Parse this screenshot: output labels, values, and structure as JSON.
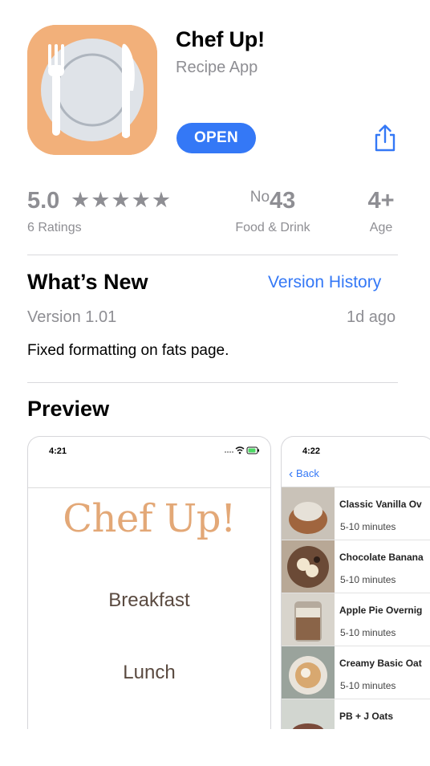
{
  "app": {
    "name": "Chef Up!",
    "subtitle": "Recipe App",
    "open_label": "OPEN",
    "icon": "fork-plate-knife-icon",
    "icon_color": "#f2b07a"
  },
  "accent_color": "#3478f6",
  "ratings": {
    "value": "5.0",
    "stars": "★★★★★",
    "count_label": "6 Ratings"
  },
  "rank": {
    "prefix": "No",
    "number": "43",
    "category": "Food & Drink"
  },
  "age": {
    "value": "4+",
    "label": "Age"
  },
  "whats_new": {
    "title": "What’s New",
    "history_link": "Version History",
    "version": "Version 1.01",
    "age": "1d ago",
    "notes": "Fixed formatting on fats page."
  },
  "preview": {
    "title": "Preview",
    "screenshot_1": {
      "time": "4:21",
      "title": "Chef Up!",
      "menu": [
        "Breakfast",
        "Lunch"
      ]
    },
    "screenshot_2": {
      "time": "4:22",
      "back_label": "Back",
      "rows": [
        {
          "name": "Classic Vanilla Ov",
          "time": "5-10 minutes"
        },
        {
          "name": "Chocolate Banana",
          "time": "5-10 minutes"
        },
        {
          "name": "Apple Pie Overnig",
          "time": "5-10 minutes"
        },
        {
          "name": "Creamy Basic Oat",
          "time": "5-10 minutes"
        },
        {
          "name": "PB + J Oats",
          "time": ""
        }
      ]
    }
  }
}
